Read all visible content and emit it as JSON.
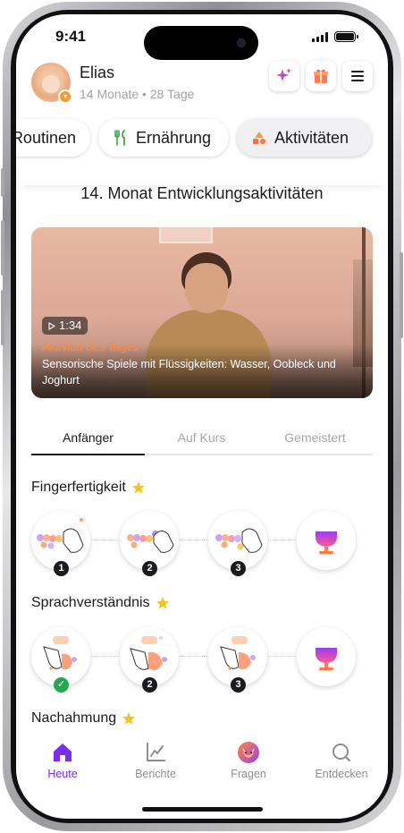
{
  "status_bar": {
    "time": "9:41"
  },
  "profile": {
    "name": "Elias",
    "age": "14 Monate • 28 Tage"
  },
  "header_buttons": [
    "sparkle-icon",
    "gift-icon",
    "menu-icon"
  ],
  "categories": [
    {
      "label": "Routinen",
      "icon": ""
    },
    {
      "label": "Ernährung",
      "icon": "fork-knife-icon"
    },
    {
      "label": "Aktivitäten",
      "icon": "shapes-icon",
      "active": true
    }
  ],
  "page_title": "14. Monat Entwicklungsaktivitäten",
  "video": {
    "duration": "1:34",
    "kicker": "Aktivität des Tages",
    "title": "Sensorische Spiele mit Flüssigkeiten: Wasser, Oobleck und Joghurt"
  },
  "level_tabs": [
    {
      "label": "Anfänger",
      "active": true
    },
    {
      "label": "Auf Kurs"
    },
    {
      "label": "Gemeistert"
    }
  ],
  "skills": [
    {
      "title": "Fingerfertigkeit",
      "steps": [
        {
          "badge": "1",
          "done": false
        },
        {
          "badge": "2",
          "done": false
        },
        {
          "badge": "3",
          "done": false
        },
        {
          "badge": "",
          "trophy": true
        }
      ]
    },
    {
      "title": "Sprachverständnis",
      "steps": [
        {
          "badge": "",
          "done": true
        },
        {
          "badge": "2",
          "done": false
        },
        {
          "badge": "3",
          "done": false
        },
        {
          "badge": "",
          "trophy": true
        }
      ]
    },
    {
      "title": "Nachahmung"
    }
  ],
  "bottom_nav": [
    {
      "label": "Heute",
      "icon": "home-icon",
      "active": true
    },
    {
      "label": "Berichte",
      "icon": "chart-icon"
    },
    {
      "label": "Fragen",
      "icon": "cat-icon"
    },
    {
      "label": "Entdecken",
      "icon": "search-icon"
    }
  ],
  "colors": {
    "accent": "#7b2cf4",
    "orange": "#ff8a3d",
    "star": "#f6c21c",
    "check": "#22a94f"
  }
}
